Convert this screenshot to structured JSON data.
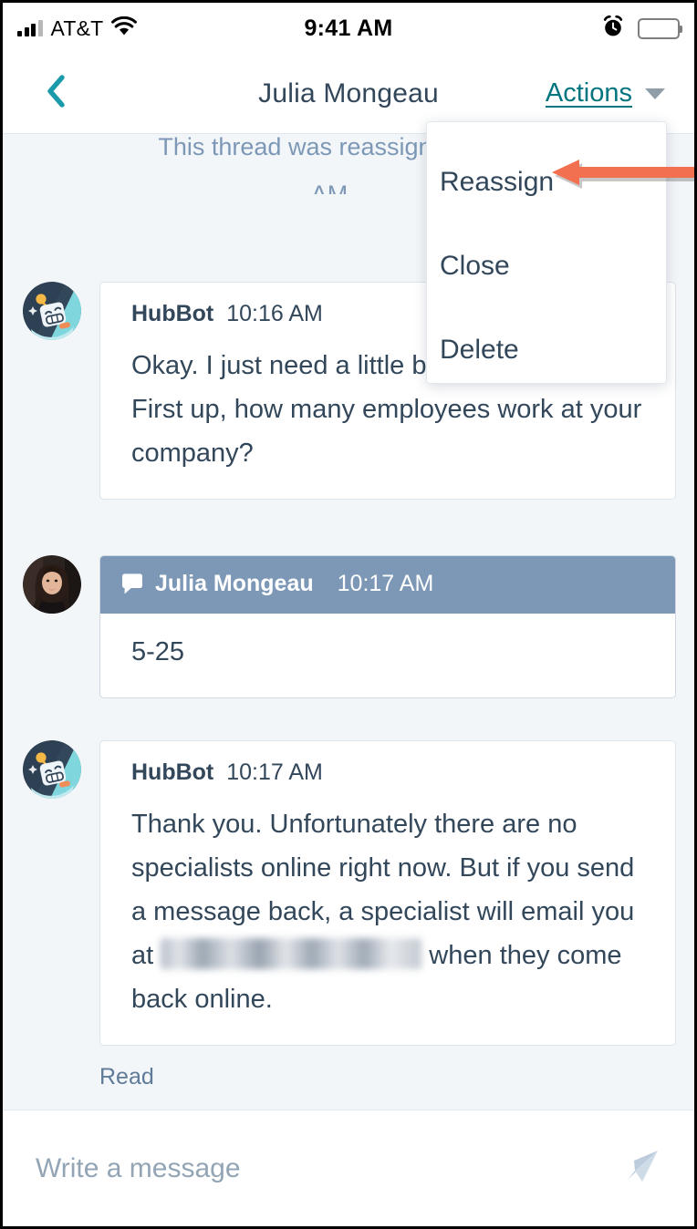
{
  "status_bar": {
    "carrier": "AT&T",
    "time": "9:41 AM",
    "signal_icon": "cellular-signal-icon",
    "wifi_icon": "wifi-icon",
    "alarm_icon": "alarm-clock-icon",
    "battery_icon": "battery-full-icon"
  },
  "nav": {
    "back_icon": "chevron-left-icon",
    "title": "Julia Mongeau",
    "actions_label": "Actions",
    "caret_icon": "chevron-down-icon"
  },
  "actions_menu": {
    "items": [
      {
        "label": "Reassign"
      },
      {
        "label": "Close"
      },
      {
        "label": "Delete"
      }
    ]
  },
  "annotation": {
    "arrow_icon": "arrow-left-annotation",
    "color": "#f2704f",
    "points_to": "Reassign"
  },
  "conversation": {
    "system_notice": {
      "line1": "This thread was reassigned to Hub",
      "line2": "AM"
    },
    "messages": [
      {
        "sender": "HubBot",
        "time": "10:16 AM",
        "avatar": "hubbot-robot-avatar",
        "type": "bot",
        "text": "Okay. I just need a little bit of information. First up, how many employees work at your company?"
      },
      {
        "sender": "Julia Mongeau",
        "time": "10:17 AM",
        "avatar": "julia-mongeau-photo-avatar",
        "type": "agent",
        "icon": "chat-bubble-icon",
        "text": "5-25"
      },
      {
        "sender": "HubBot",
        "time": "10:17 AM",
        "avatar": "hubbot-robot-avatar",
        "type": "bot",
        "text_before_email": "Thank you. Unfortunately there are no specialists online right now. But if you send a message back, a specialist will email you at ",
        "email_redacted": true,
        "text_after_email": " when they come back online."
      }
    ],
    "read_receipt": "Read"
  },
  "composer": {
    "placeholder": "Write a message",
    "value": "",
    "send_icon": "send-paper-plane-icon"
  },
  "colors": {
    "accent_teal": "#00747f",
    "text_navy": "#33475b",
    "agent_header_blue": "#7c98b6",
    "chat_background": "#f3f6f9",
    "annotation_orange": "#f2704f"
  }
}
